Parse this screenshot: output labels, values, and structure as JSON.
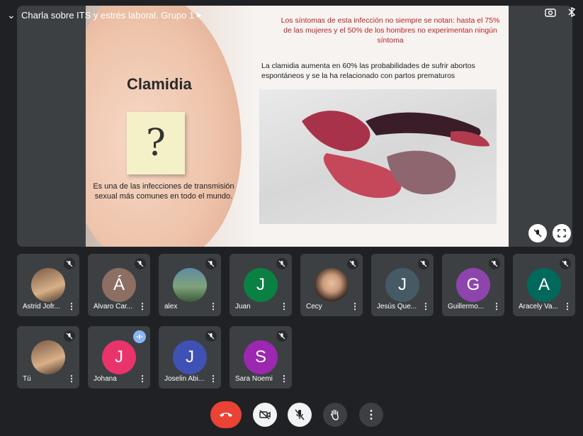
{
  "meeting": {
    "title": "Charla sobre ITS y estrés laboral. Grupo 1",
    "title_chevron": "▸"
  },
  "slide": {
    "heading": "Clamidia",
    "note_symbol": "?",
    "caption": "Es una de las infecciones de transmisión sexual más comunes en todo el mundo.",
    "red_text": "Los síntomas de esta infección no siempre se notan: hasta el 75% de las mujeres y el 50% de los hombres no experimentan ningún síntoma",
    "body_text": "La clamidia aumenta en 60% las probabilidades de sufrir abortos espontáneos y se la ha relacionado con partos prematuros"
  },
  "participants": [
    {
      "name": "Astrid Jofr...",
      "avatar_type": "photo",
      "muted": true
    },
    {
      "name": "Álvaro Car...",
      "initial": "Á",
      "color": "#8d6e63",
      "muted": true
    },
    {
      "name": "alex",
      "avatar_type": "photo",
      "muted": true
    },
    {
      "name": "Juan",
      "initial": "J",
      "color": "#0b8043",
      "muted": true
    },
    {
      "name": "Cecy",
      "avatar_type": "photo",
      "muted": true
    },
    {
      "name": "Jesús Que...",
      "initial": "J",
      "color": "#455a64",
      "muted": true
    },
    {
      "name": "Guillermo...",
      "initial": "G",
      "color": "#8e44ad",
      "muted": true
    },
    {
      "name": "Aracely Va...",
      "initial": "A",
      "color": "#00695c",
      "muted": true
    },
    {
      "name": "Tú",
      "avatar_type": "photo",
      "muted": true
    },
    {
      "name": "Johana",
      "initial": "J",
      "color": "#e8336b",
      "muted": false,
      "speaking": true
    },
    {
      "name": "Joselin Abi...",
      "initial": "J",
      "color": "#3f51b5",
      "muted": true
    },
    {
      "name": "Sara Noemi",
      "initial": "S",
      "color": "#9c27b0",
      "muted": true
    }
  ],
  "controls": {
    "end_call": "end-call",
    "camera": "camera-off",
    "mic": "mic-off",
    "raise_hand": "raise-hand",
    "more": "more-options"
  },
  "colors": {
    "end_call": "#ea4335",
    "tile_bg": "#3c4043",
    "app_bg": "#202124",
    "slide_red": "#b8232a"
  }
}
